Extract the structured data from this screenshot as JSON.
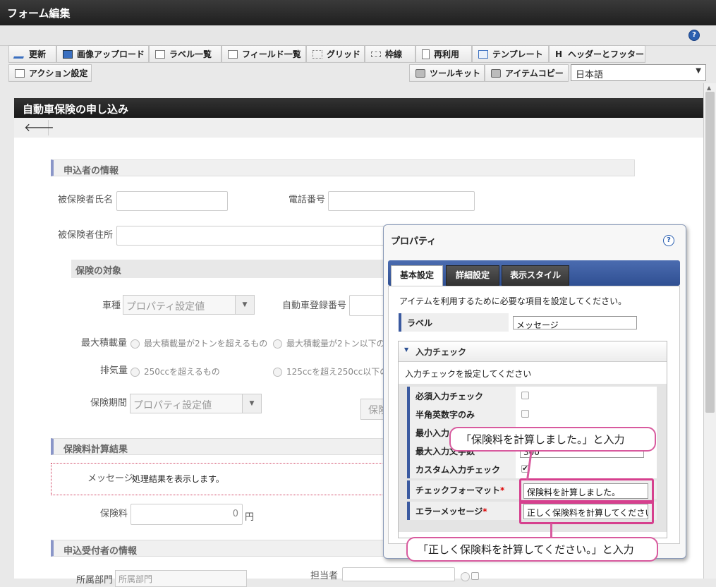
{
  "window": {
    "title": "フォーム編集",
    "help": "?"
  },
  "toolbar": {
    "row1": [
      "更新",
      "画像アップロード",
      "ラベル一覧",
      "フィールド一覧",
      "グリッド",
      "枠線",
      "再利用",
      "テンプレート",
      "ヘッダーとフッター"
    ],
    "row2_left": "アクション設定",
    "row2_right": [
      "ツールキット",
      "アイテムコピー"
    ],
    "language": "日本語",
    "header_icon_letter": "H"
  },
  "form": {
    "title": "自動車保険の申し込み",
    "back": "🡐",
    "sections": {
      "applicant": "申込者の情報",
      "coverage": "保険の対象",
      "result": "保険料計算結果",
      "receiver": "申込受付者の情報"
    },
    "labels": {
      "insured_name": "被保険者氏名",
      "phone": "電話番号",
      "insured_address": "被保険者住所",
      "car_type": "車種",
      "registration_no": "自動車登録番号",
      "max_load": "最大積載量",
      "displacement": "排気量",
      "period": "保険期間",
      "message": "メッセージ",
      "premium": "保険料",
      "department": "所属部門",
      "staff": "担当者"
    },
    "car_type_select": "プロパティ設定値",
    "period_select": "プロパティ設定値",
    "dept_select": "所属部門",
    "max_load_options": [
      "最大積載量が2トンを超えるもの",
      "最大積載量が2トン以下の"
    ],
    "displacement_options": [
      "250ccを超えるもの",
      "125ccを超え250cc以下の"
    ],
    "calc_button_partial": "保険",
    "message_text": "処理結果を表示します。",
    "premium_value": "0",
    "premium_unit": "円"
  },
  "properties": {
    "title": "プロパティ",
    "help": "?",
    "tabs": [
      "基本設定",
      "詳細設定",
      "表示スタイル"
    ],
    "description": "アイテムを利用するために必要な項目を設定してください。",
    "label_field": {
      "label": "ラベル",
      "value": "メッセージ"
    },
    "input_check": {
      "title": "入力チェック",
      "description": "入力チェックを設定してください",
      "required": {
        "label": "必須入力チェック",
        "checked": false
      },
      "alnum": {
        "label": "半角英数字のみ",
        "checked": false
      },
      "min_length": {
        "label": "最小入力"
      },
      "max_length": {
        "label": "最大入力文字数",
        "value": "300"
      },
      "custom": {
        "label": "カスタム入力チェック",
        "checked": true
      },
      "format": {
        "label": "チェックフォーマット",
        "value": "保険料を計算しました。"
      },
      "error": {
        "label": "エラーメッセージ",
        "value": "正しく保険料を計算してください。"
      }
    }
  },
  "callouts": {
    "format": "「保険料を計算しました。」と入力",
    "error": "「正しく保険料を計算してください。」と入力"
  },
  "colors": {
    "titlebar": "#2a2a2a",
    "accent": "#3b5aa0",
    "highlight": "#d6408e",
    "section_bar": "#8a96c8"
  }
}
